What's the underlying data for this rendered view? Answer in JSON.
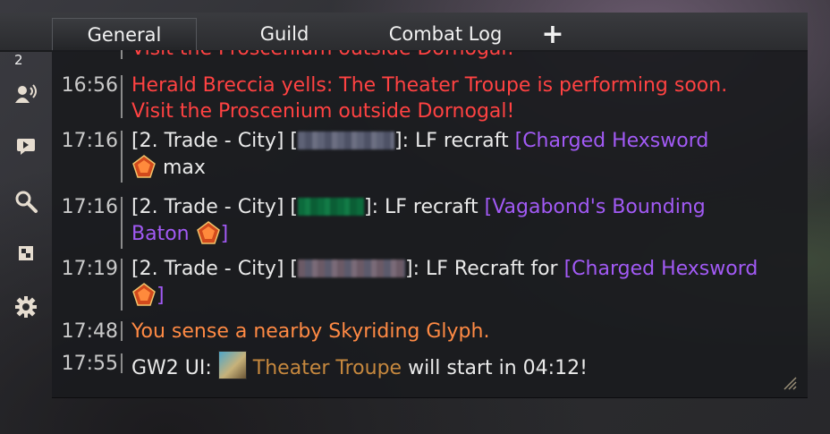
{
  "sidebar": {
    "badge": "2",
    "icons": [
      "friends-icon",
      "voice-icon",
      "chat-bubble-icon",
      "search-icon",
      "share-icon",
      "settings-icon"
    ]
  },
  "tabs": {
    "general": "General",
    "guild": "Guild",
    "combat_log": "Combat Log",
    "add": "+"
  },
  "chat": {
    "partial_line": "Visit the Proscenium outside Dornogal!",
    "messages": [
      {
        "time": "16:56",
        "text1": "Herald Breccia yells: The Theater Troupe is performing soon.",
        "text2": "Visit the Proscenium outside Dornogal!"
      },
      {
        "time": "17:16",
        "channel": "[2. Trade - City] [",
        "after_name": "]: LF recraft ",
        "link": "[Charged Hexsword",
        "tail": " max"
      },
      {
        "time": "17:16",
        "channel": "[2. Trade - City] [",
        "after_name": "]: LF recraft ",
        "link1": "[Vagabond's Bounding",
        "link2": "Baton",
        "link_end": "]"
      },
      {
        "time": "17:19",
        "channel": "[2. Trade - City] [",
        "after_name": "]: LF Recraft for ",
        "link": "[Charged Hexsword",
        "link_end": "]"
      },
      {
        "time": "17:48",
        "text": "You sense a nearby Skyriding Glyph."
      },
      {
        "time": "17:55",
        "prefix": "GW2 UI: ",
        "event": "Theater Troupe",
        "suffix": " will start in 04:12!"
      }
    ]
  },
  "colors": {
    "yell": "#ff4242",
    "item_link": "#a25af5",
    "system": "#ff8a44",
    "event": "#c6883e"
  }
}
